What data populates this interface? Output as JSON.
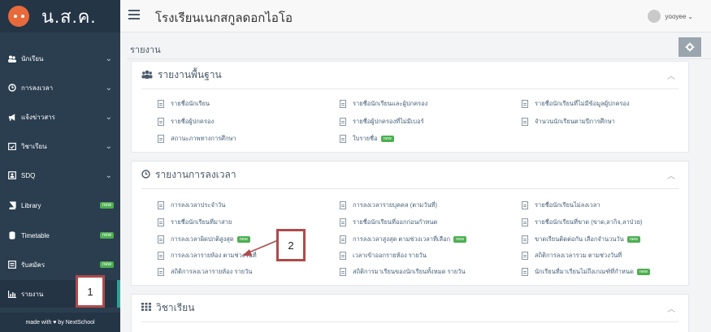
{
  "brand": {
    "logo_icon": "owl-logo-icon",
    "text": "น.ส.ค."
  },
  "sidebar": {
    "items": [
      {
        "label": "นักเรียน",
        "icon": "users-icon",
        "has_new": false
      },
      {
        "label": "การลงเวลา",
        "icon": "clock-icon",
        "has_new": false
      },
      {
        "label": "แจ้งข่าวสาร",
        "icon": "megaphone-icon",
        "has_new": false
      },
      {
        "label": "วิชาเรียน",
        "icon": "calendar-check-icon",
        "has_new": false
      },
      {
        "label": "SDQ",
        "icon": "id-card-icon",
        "has_new": false
      },
      {
        "label": "Library",
        "icon": "book-icon",
        "has_new": true
      },
      {
        "label": "Timetable",
        "icon": "database-icon",
        "has_new": true
      },
      {
        "label": "รับสมัคร",
        "icon": "form-icon",
        "has_new": true
      },
      {
        "label": "รายงาน",
        "icon": "bar-chart-icon",
        "has_new": false,
        "active": true
      }
    ],
    "new_label": "new",
    "footer": "made with ♥ by NextSchool"
  },
  "topbar": {
    "school_name": "โรงเรียนเนกสกูลดอกไอโอ",
    "user_name": "yooyee"
  },
  "page": {
    "title": "รายงาน"
  },
  "panels": [
    {
      "title": "รายงานพื้นฐาน",
      "icon": "users-icon",
      "items": [
        {
          "label": "รายชื่อนักเรียน",
          "new": false
        },
        {
          "label": "รายชื่อนักเรียนและผู้ปกครอง",
          "new": false
        },
        {
          "label": "รายชื่อนักเรียนที่ไม่มีข้อมูลผู้ปกครอง",
          "new": false
        },
        {
          "label": "รายชื่อผู้ปกครอง",
          "new": false
        },
        {
          "label": "รายชื่อผู้ปกครองที่ไม่มีเบอร์",
          "new": false
        },
        {
          "label": "จำนวนนักเรียนตามปีการศึกษา",
          "new": false
        },
        {
          "label": "สถานะภาพทางการศึกษา",
          "new": false
        },
        {
          "label": "ใบรายชื่อ",
          "new": true
        }
      ]
    },
    {
      "title": "รายงานการลงเวลา",
      "icon": "clock-icon",
      "items": [
        {
          "label": "การลงเวลาประจำวัน",
          "new": false
        },
        {
          "label": "การลงเวลารายบุคคล (ตามวันที่)",
          "new": false
        },
        {
          "label": "รายชื่อนักเรียนไม่ลงเวลา",
          "new": false
        },
        {
          "label": "รายชื่อนักเรียนที่มาสาย",
          "new": false
        },
        {
          "label": "รายชื่อนักเรียนที่ออกก่อนกำหนด",
          "new": false
        },
        {
          "label": "รายชื่อนักเรียนที่ขาด (ขาด,ลากิจ,ลาป่วย)",
          "new": false
        },
        {
          "label": "การลงเวลาผิดปกติสูงสุด",
          "new": true
        },
        {
          "label": "การลงเวลาสูงสุด ตามช่วงเวลาที่เลือก",
          "new": true
        },
        {
          "label": "ขาดเรียนติดต่อกัน เลือกจำนวนวัน",
          "new": true
        },
        {
          "label": "การลงเวลารายห้อง ตามช่วงวันที่",
          "new": false
        },
        {
          "label": "เวลาเข้าออกรายห้อง รายวัน",
          "new": false
        },
        {
          "label": "สถิติการลงเวลารวม ตามช่วงวันที่",
          "new": false
        },
        {
          "label": "สถิติการลงเวลารายห้อง รายวัน",
          "new": false
        },
        {
          "label": "สถิติการมาเรียนของนักเรียนทั้งหมด รายวัน",
          "new": false
        },
        {
          "label": "นักเรียนที่มาเรียนไม่ถึงเกณฑ์ที่กำหนด",
          "new": true
        }
      ]
    },
    {
      "title": "วิชาเรียน",
      "icon": "grid-icon",
      "items": []
    }
  ],
  "annotations": {
    "one": "1",
    "two": "2",
    "arrow_color": "#b04a4a"
  }
}
